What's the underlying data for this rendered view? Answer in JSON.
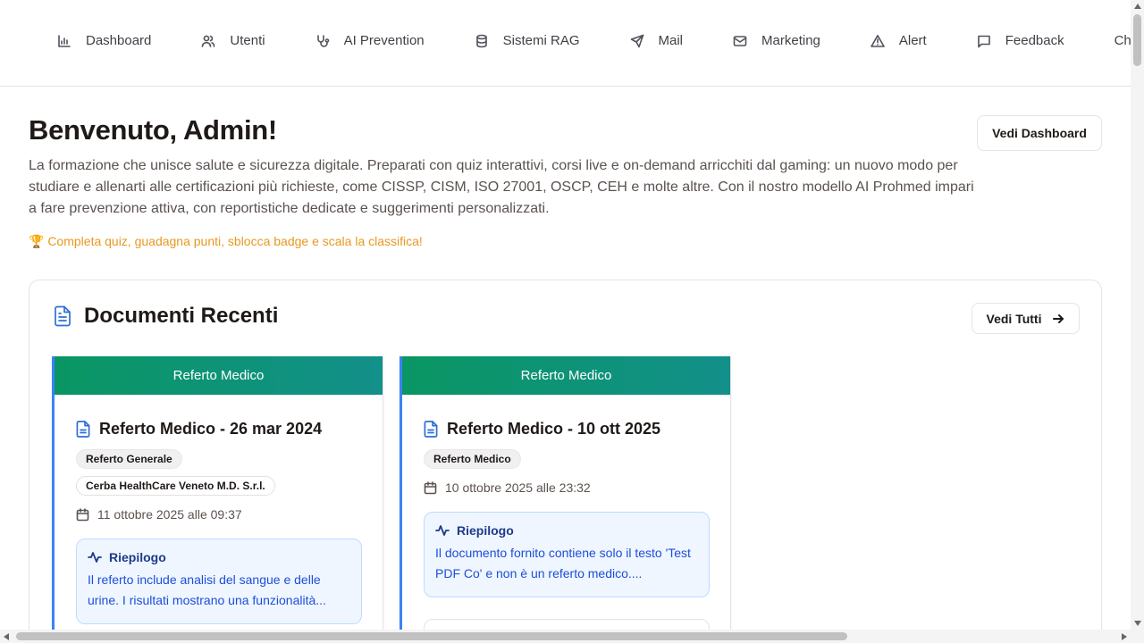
{
  "nav": {
    "items": [
      {
        "label": "Dashboard",
        "icon": "bar-chart-icon"
      },
      {
        "label": "Utenti",
        "icon": "users-icon"
      },
      {
        "label": "AI Prevention",
        "icon": "stethoscope-icon"
      },
      {
        "label": "Sistemi RAG",
        "icon": "database-icon"
      },
      {
        "label": "Mail",
        "icon": "send-icon"
      },
      {
        "label": "Marketing",
        "icon": "mail-icon"
      },
      {
        "label": "Alert",
        "icon": "alert-triangle-icon"
      },
      {
        "label": "Feedback",
        "icon": "message-square-icon"
      },
      {
        "label": "Chi",
        "icon": ""
      }
    ]
  },
  "welcome": {
    "title": "Benvenuto, Admin!",
    "description": "La formazione che unisce salute e sicurezza digitale. Preparati con quiz interattivi, corsi live e on-demand arricchiti dal gaming: un nuovo modo per studiare e allenarti alle certificazioni più richieste, come CISSP, CISM, ISO 27001, OSCP, CEH e molte altre. Con il nostro modello AI Prohmed impari a fare prevenzione attiva, con reportistiche dedicate e suggerimenti personalizzati.",
    "cta": "🏆 Completa quiz, guadagna punti, sblocca badge e scala la classifica!",
    "dashboard_button": "Vedi Dashboard"
  },
  "recent_docs": {
    "title": "Documenti Recenti",
    "view_all": "Vedi Tutti",
    "cards": [
      {
        "header": "Referto Medico",
        "title": "Referto Medico - 26 mar 2024",
        "tags": [
          "Referto Generale",
          "Cerba HealthCare Veneto M.D. S.r.l."
        ],
        "date": "11 ottobre 2025 alle 09:37",
        "summary_label": "Riepilogo",
        "summary": "Il referto include analisi del sangue e delle urine. I risultati mostrano una funzionalità..."
      },
      {
        "header": "Referto Medico",
        "title": "Referto Medico - 10 ott 2025",
        "tags": [
          "Referto Medico"
        ],
        "date": "10 ottobre 2025 alle 23:32",
        "summary_label": "Riepilogo",
        "summary": "Il documento fornito contiene solo il testo 'Test PDF Co' e non è un referto medico...."
      }
    ]
  },
  "colors": {
    "accent_blue": "#2f6fd6",
    "card_header_green": "#0a9663",
    "cta_orange": "#e7981f"
  }
}
